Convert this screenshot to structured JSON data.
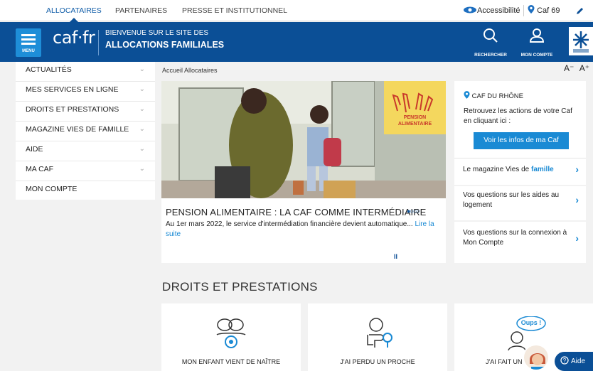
{
  "top_nav": {
    "tabs": [
      "ALLOCATAIRES",
      "PARTENAIRES",
      "PRESSE ET INSTITUTIONNEL"
    ],
    "accessibility": "Accessibilité",
    "caf_location": "Caf 69"
  },
  "header": {
    "menu_label": "MENU",
    "logo": "caf·fr",
    "welcome_line1": "BIENVENUE SUR LE SITE DES",
    "welcome_line2": "ALLOCATIONS FAMILIALES",
    "search_label": "RECHERCHER",
    "account_label": "MON COMPTE"
  },
  "sidebar": {
    "items": [
      {
        "label": "ACTUALITÉS",
        "chevron": "⌄"
      },
      {
        "label": "MES SERVICES EN LIGNE",
        "chevron": "⌄"
      },
      {
        "label": "DROITS ET PRESTATIONS",
        "chevron": "⌄"
      },
      {
        "label": "MAGAZINE VIES DE FAMILLE",
        "chevron": "⌄"
      },
      {
        "label": "AIDE",
        "chevron": "⌄"
      },
      {
        "label": "MA CAF",
        "chevron": "⌄"
      },
      {
        "label": "MON COMPTE",
        "chevron": ""
      }
    ]
  },
  "breadcrumb": "Accueil Allocataires",
  "font_size_controls": {
    "decrease": "A⁻",
    "increase": "A⁺"
  },
  "hero": {
    "badge_line1": "PENSION",
    "badge_line2": "ALIMENTAIRE",
    "title": "PENSION ALIMENTAIRE : LA CAF COMME INTERMÉDIAIRE",
    "text": "Au 1er mars 2022, le service d'intermédiation financière devient automatique...",
    "more": "Lire la suite",
    "dots": "●○○○",
    "pause": "II"
  },
  "caf_box": {
    "title": "CAF DU RHÔNE",
    "text": "Retrouvez les actions de votre Caf en cliquant ici :",
    "button": "Voir les infos de ma Caf"
  },
  "links": [
    {
      "text": "Le magazine Vies de ",
      "bold": "famille"
    },
    {
      "text": "Vos questions sur les aides au logement",
      "bold": ""
    },
    {
      "text": "Vos questions sur la connexion à Mon Compte",
      "bold": ""
    }
  ],
  "section_title": "DROITS ET PRESTATIONS",
  "cards": [
    {
      "label": "MON ENFANT VIENT DE NAÎTRE"
    },
    {
      "label": "J'AI PERDU UN PROCHE"
    },
    {
      "label": "J'AI FAIT UN",
      "bubble": "Oups !"
    }
  ],
  "help": {
    "label": "Aide"
  },
  "colors": {
    "brand_blue": "#0b4f96",
    "accent_blue": "#1a8ad4",
    "badge_yellow": "#f4d75e"
  }
}
